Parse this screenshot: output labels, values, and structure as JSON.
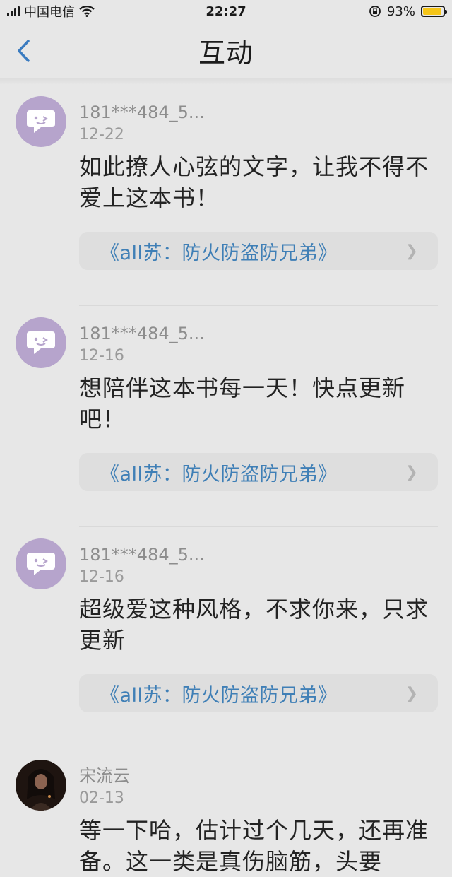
{
  "status_bar": {
    "carrier": "中国电信",
    "time": "22:27",
    "battery": "93%",
    "battery_level": 0.93
  },
  "nav": {
    "title": "互动",
    "back_icon": "chevron-left-icon"
  },
  "comments": [
    {
      "user": "181***484_5...",
      "date": "12-22",
      "text": "如此撩人心弦的文字，让我不得不爱上这本书！",
      "book": "《all苏：防火防盗防兄弟》"
    },
    {
      "user": "181***484_5...",
      "date": "12-16",
      "text": "想陪伴这本书每一天！快点更新吧！",
      "book": "《all苏：防火防盗防兄弟》"
    },
    {
      "user": "181***484_5...",
      "date": "12-16",
      "text": "超级爱这种风格，不求你来，只求更新",
      "book": "《all苏：防火防盗防兄弟》"
    },
    {
      "user": "宋流云",
      "date": "02-13",
      "text": "等一下哈，估计过个几天，还再准备。这一类是真伤脑筋，头要"
    }
  ],
  "colors": {
    "link": "#3f7fb6",
    "avatar_bot": "#b6a4cc",
    "battery": "#f5c518"
  }
}
